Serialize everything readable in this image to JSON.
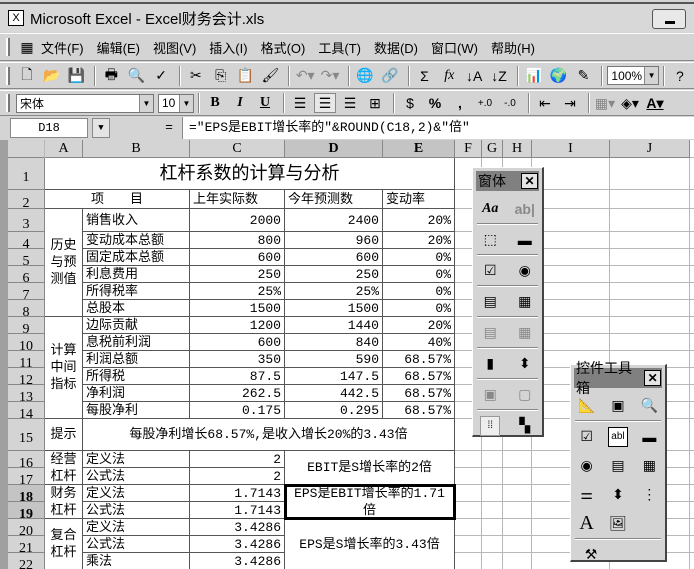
{
  "window": {
    "title": "Microsoft Excel - Excel财务会计.xls"
  },
  "menu": [
    "文件(F)",
    "编辑(E)",
    "视图(V)",
    "插入(I)",
    "格式(O)",
    "工具(T)",
    "数据(D)",
    "窗口(W)",
    "帮助(H)"
  ],
  "toolbar": {
    "zoom": "100%",
    "font": "宋体",
    "size": "10",
    "bold": "B",
    "italic": "I",
    "underline": "U",
    "percent": "%",
    "comma": ",",
    "sigma": "Σ",
    "fx": "fx"
  },
  "formula_bar": {
    "name_box": "D18",
    "equals": "=",
    "formula": "=\"EPS是EBIT增长率的\"&ROUND(C18,2)&\"倍\""
  },
  "columns": [
    "A",
    "B",
    "C",
    "D",
    "E",
    "F",
    "G",
    "H",
    "I",
    "J"
  ],
  "rows": [
    "1",
    "2",
    "3",
    "4",
    "5",
    "6",
    "7",
    "8",
    "9",
    "10",
    "11",
    "12",
    "13",
    "14",
    "15",
    "16",
    "17",
    "18",
    "19",
    "20",
    "21",
    "22"
  ],
  "cells": {
    "A1": "杠杆系数的计算与分析",
    "A2": "项　　目",
    "C2": "上年实际数",
    "D2": "今年预测数",
    "E2": "变动率",
    "A3": "历史与预测值",
    "A9": "计算中间指标",
    "B3": "销售收入",
    "C3": "2000",
    "D3": "2400",
    "E3": "20%",
    "B4": "变动成本总额",
    "C4": "800",
    "D4": "960",
    "E4": "20%",
    "B5": "固定成本总额",
    "C5": "600",
    "D5": "600",
    "E5": "0%",
    "B6": "利息费用",
    "C6": "250",
    "D6": "250",
    "E6": "0%",
    "B7": "所得税率",
    "C7": "25%",
    "D7": "25%",
    "E7": "0%",
    "B8": "总股本",
    "C8": "1500",
    "D8": "1500",
    "E8": "0%",
    "B9": "边际贡献",
    "C9": "1200",
    "D9": "1440",
    "E9": "20%",
    "B10": "息税前利润",
    "C10": "600",
    "D10": "840",
    "E10": "40%",
    "B11": "利润总额",
    "C11": "350",
    "D11": "590",
    "E11": "68.57%",
    "B12": "所得税",
    "C12": "87.5",
    "D12": "147.5",
    "E12": "68.57%",
    "B13": "净利润",
    "C13": "262.5",
    "D13": "442.5",
    "E13": "68.57%",
    "B14": "每股净利",
    "C14": "0.175",
    "D14": "0.295",
    "E14": "68.57%",
    "A15": "提示",
    "B15": "每股净利增长68.57%,是收入增长20%的3.43倍",
    "A16": "经营杠杆",
    "B16": "定义法",
    "C16": "2",
    "B17": "公式法",
    "C17": "2",
    "D16": "EBIT是S增长率的2倍",
    "A18": "财务杠杆",
    "B18": "定义法",
    "C18": "1.7143",
    "B19": "公式法",
    "C19": "1.7143",
    "D18": "EPS是EBIT增长率的1.71倍",
    "A20": "复合杠杆",
    "B20": "定义法",
    "C20": "3.4286",
    "B21": "公式法",
    "C21": "3.4286",
    "B22": "乘法",
    "C22": "3.4286",
    "D20": "EPS是S增长率的3.43倍"
  },
  "forms_toolbar": {
    "title": "窗体",
    "label_icon": "Aa",
    "edit_icon": "ab|"
  },
  "controls_toolbar": {
    "title": "控件工具箱",
    "label_icon": "A"
  }
}
